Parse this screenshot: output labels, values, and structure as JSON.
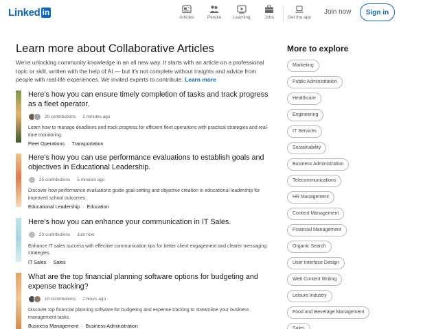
{
  "header": {
    "logo_text": "Linked",
    "logo_box": "in",
    "nav": [
      {
        "label": "Articles"
      },
      {
        "label": "People"
      },
      {
        "label": "Learning"
      },
      {
        "label": "Jobs"
      }
    ],
    "get_app": "Get the app",
    "join": "Join now",
    "signin": "Sign in"
  },
  "main": {
    "title": "Learn more about Collaborative Articles",
    "intro": "We're unlocking community knowledge in an all new way. It starts with an article on a professional topic or skill, written with the help of AI — but it's not complete without insights and advice from people with real-life experiences. We invited experts to contribute.",
    "learn_more": "Learn more",
    "articles": [
      {
        "title": "Here's how you can ensure timely completion of tasks and track progress as a fleet operator.",
        "contributions": "20 contributions",
        "time": "2 minutes ago",
        "description": "Learn how to manage deadlines and track progress for efficient fleet operations with practical strategies and real-time monitoring.",
        "tags": [
          "Fleet Operations",
          "Transportation"
        ],
        "stripe_colors": [
          "#7a9a4a",
          "#e9b36b",
          "#3d5a2a"
        ]
      },
      {
        "title": "Here's how you can use performance evaluations to establish goals and objectives in Educational Leadership.",
        "contributions": "25 contributions",
        "time": "5 minutes ago",
        "description": "Discover how performance evaluations guide goal-setting and objective creation in educational leadership for improved school outcomes.",
        "tags": [
          "Educational Leadership",
          "Education"
        ],
        "stripe_colors": [
          "#f2c38a",
          "#e07b4a",
          "#f7dcb4"
        ]
      },
      {
        "title": "Here's how you can enhance your communication in IT Sales.",
        "contributions": "23 contributions",
        "time": "Just now",
        "description": "Enhance IT sales success with effective communication tips for better client engagement and clearer messaging strategies.",
        "tags": [
          "IT Sales",
          "Sales"
        ],
        "stripe_colors": [
          "#bfe3ec",
          "#a6d6e2",
          "#d5eef3"
        ]
      },
      {
        "title": "What are the top financial planning software options for budgeting and expense tracking?",
        "contributions": "10 contributions",
        "time": "2 hours ago",
        "description": "Discover top financial planning software for budgeting and expense tracking to streamline your business management tasks.",
        "tags": [
          "Business Management",
          "Business Administration"
        ],
        "stripe_colors": [
          "#e8a05a",
          "#f3c99b",
          "#d98b45"
        ]
      }
    ]
  },
  "sidebar": {
    "title": "More to explore",
    "pills": [
      "Marketing",
      "Public Administration",
      "Healthcare",
      "Engineering",
      "IT Services",
      "Sustainability",
      "Business Administration",
      "Telecommunications",
      "HR Management",
      "Content Management",
      "Financial Management",
      "Organic Search",
      "User Interface Design",
      "Web Content Writing",
      "Leisure Industry",
      "Food and Beverage Management",
      "Sales"
    ]
  },
  "colors": {
    "brand": "#0a66c2",
    "muted": "#666666"
  }
}
